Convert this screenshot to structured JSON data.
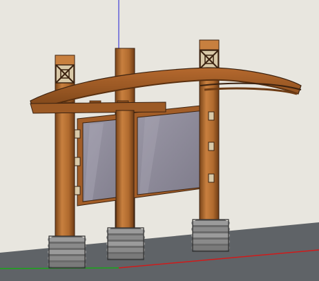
{
  "scene": {
    "description_visible_text": "",
    "colors": {
      "sky": "#e8e6df",
      "ground": "#5f6367",
      "ground_shadow": "#4e5256",
      "wood_light": "#c8803f",
      "wood_mid": "#a9642b",
      "wood_dark": "#7a4418",
      "wood_outline": "#3b2210",
      "panel_glass": "#8e8b99",
      "panel_glass_light": "#a9a6b3",
      "stone_light": "#8a8a8a",
      "stone_dark": "#3f3f3f",
      "axis_blue": "#1b1bd6",
      "axis_green": "#19a619",
      "axis_red": "#d11a1a"
    },
    "icons": [
      "lattice-ornament-icon",
      "axis-lines"
    ]
  }
}
